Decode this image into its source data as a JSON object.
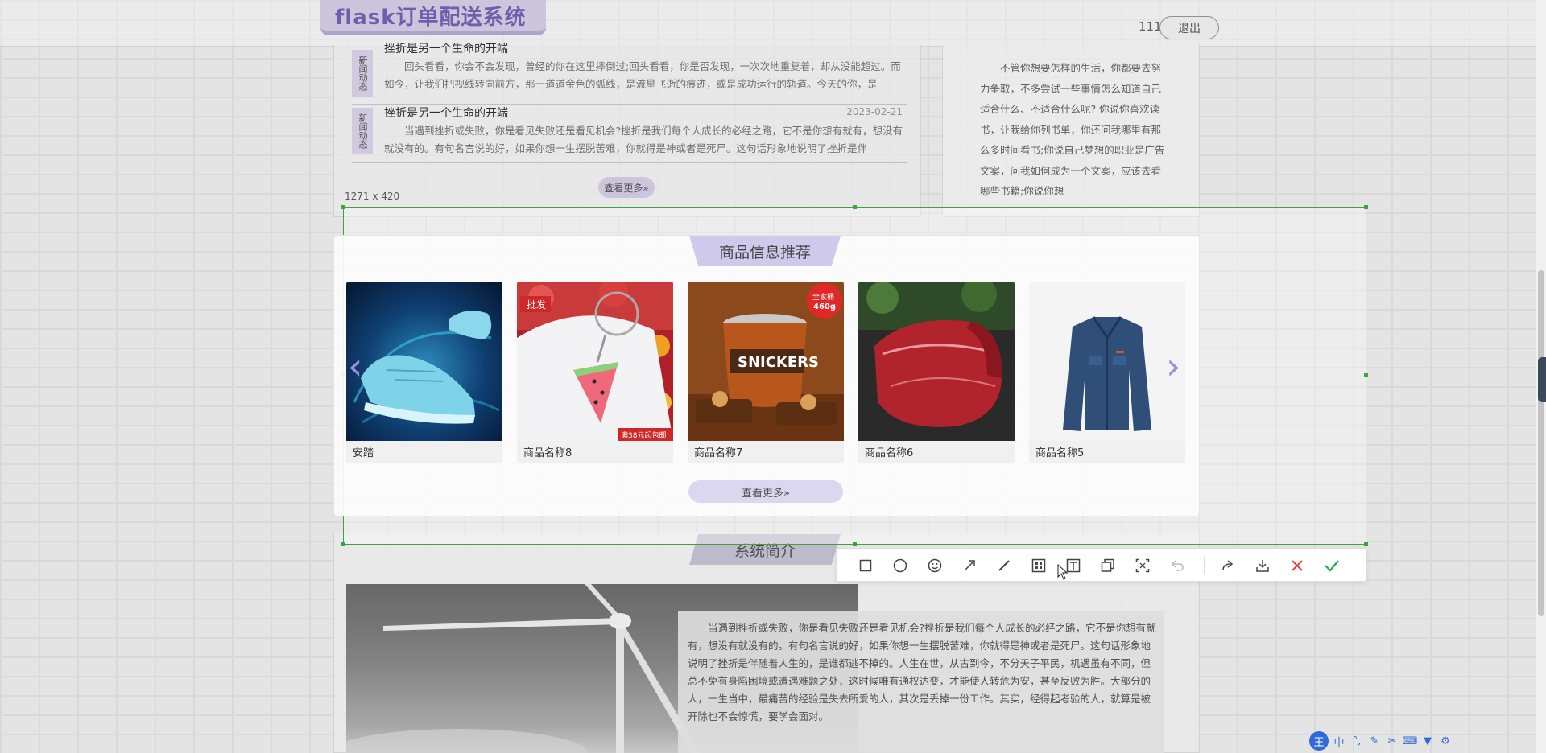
{
  "header": {
    "logo": "flask订单配送系统",
    "user": "111",
    "logout": "退出"
  },
  "news": {
    "items": [
      {
        "tag": "新闻动态",
        "title": "挫折是另一个生命的开端",
        "date": "",
        "body": "回头看看，你会不会发现，曾经的你在这里摔倒过;回头看看，你是否发现，一次次地重复着，却从没能超过。而如今，让我们把视线转向前方，那一道道金色的弧线，是流星飞逝的痕迹，或是成功运行的轨道。今天的你，是"
      },
      {
        "tag": "新闻动态",
        "title": "挫折是另一个生命的开端",
        "date": "2023-02-21",
        "body": "当遇到挫折或失败，你是看见失败还是看见机会?挫折是我们每个人成长的必经之路，它不是你想有就有，想没有就没有的。有句名言说的好，如果你想一生摆脱苦难，你就得是神或者是死尸。这句话形象地说明了挫折是伴"
      }
    ],
    "more": "查看更多»"
  },
  "side_text": "不管你想要怎样的生活，你都要去努力争取，不多尝试一些事情怎么知道自己适合什么、不适合什么呢? 你说你喜欢读书，让我给你列书单，你还问我哪里有那么多时间看书;你说自己梦想的职业是广告文案，问我如何成为一个文案，应该去看哪些书籍;你说你想",
  "selection": {
    "size_label": "1271 x 420"
  },
  "products": {
    "title": "商品信息推荐",
    "items": [
      {
        "name": "安踏",
        "image": "sneaker"
      },
      {
        "name": "商品名称8",
        "image": "watermelon-keychain",
        "badge_top": "批发",
        "badge_bottom": "满38元起包邮"
      },
      {
        "name": "商品名称7",
        "image": "snickers-tub",
        "badge_top": "全家桶 460g"
      },
      {
        "name": "商品名称6",
        "image": "raw-beef"
      },
      {
        "name": "商品名称5",
        "image": "denim-jacket"
      }
    ],
    "more": "查看更多»"
  },
  "intro": {
    "title": "系统简介",
    "body": "当遇到挫折或失败，你是看见失败还是看见机会?挫折是我们每个人成长的必经之路，它不是你想有就有，想没有就没有的。有句名言说的好，如果你想一生摆脱苦难，你就得是神或者是死尸。这句话形象地说明了挫折是伴随着人生的，是谁都逃不掉的。人生在世，从古到今，不分天子平民，机遇虽有不同，但总不免有身陷困境或遭遇难题之处，这时候唯有通权达变，才能使人转危为安，甚至反败为胜。大部分的人，一生当中，最痛苦的经验是失去所爱的人，其次是丢掉一份工作。其实，经得起考验的人，就算是被开除也不会惊慌，要学会面对。"
  },
  "toolbar": {
    "tools": [
      "rectangle-icon",
      "ellipse-icon",
      "emoji-icon",
      "arrow-icon",
      "line-icon",
      "mosaic-icon",
      "text-icon",
      "copy-icon",
      "ocr-icon",
      "undo-icon",
      "share-icon",
      "download-icon",
      "cancel-icon",
      "confirm-icon"
    ]
  },
  "ime": {
    "logo": "王",
    "mode": "中"
  },
  "colors": {
    "accent": "#9c8ee0",
    "selection": "#3da33d",
    "cancel": "#e64545",
    "confirm": "#2aa84a"
  }
}
